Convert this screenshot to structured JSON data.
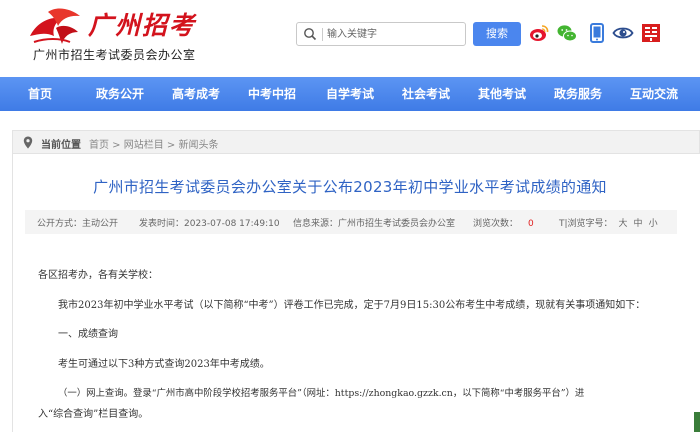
{
  "header": {
    "logo_text": "广州招考",
    "org_name": "广州市招生考试委员会办公室",
    "search": {
      "placeholder": "输入关键字",
      "button_label": "搜索"
    },
    "social_icons": [
      "weibo-icon",
      "wechat-icon",
      "mobile-icon",
      "eye-icon",
      "seal-icon"
    ],
    "brand_color": "#d3131d",
    "accent_color": "#4b86ee"
  },
  "nav": {
    "items": [
      {
        "label": "首页"
      },
      {
        "label": "政务公开"
      },
      {
        "label": "高考成考"
      },
      {
        "label": "中考中招"
      },
      {
        "label": "自学考试"
      },
      {
        "label": "社会考试"
      },
      {
        "label": "其他考试"
      },
      {
        "label": "政务服务"
      },
      {
        "label": "互动交流"
      }
    ]
  },
  "breadcrumb": {
    "label": "当前位置",
    "path": "首页 > 网站栏目 > 新闻头条"
  },
  "article": {
    "title": "广州市招生考试委员会办公室关于公布2023年初中学业水平考试成绩的通知",
    "meta": {
      "disclosure": "公开方式：主动公开",
      "publish_time": "发表时间：2023-07-08 17:49:10",
      "source": "信息来源：广州市招生考试委员会办公室",
      "views_label": "浏览次数：",
      "views_value": "0",
      "font_size_label": "T|浏览字号：",
      "size_large": "大",
      "size_medium": "中",
      "size_small": "小"
    },
    "paragraphs": [
      "各区招考办，各有关学校：",
      "我市2023年初中学业水平考试（以下简称“中考”）评卷工作已完成，定于7月9日15:30公布考生中考成绩，现就有关事项通知如下：",
      "一、成绩查询",
      "考生可通过以下3种方式查询2023年中考成绩。",
      "（一）网上查询。登录“广州市高中阶段学校招考服务平台”（网址：https://zhongkao.gzzk.cn，以下简称“中考服务平台”）进",
      "入“综合查询”栏目查询。"
    ]
  }
}
